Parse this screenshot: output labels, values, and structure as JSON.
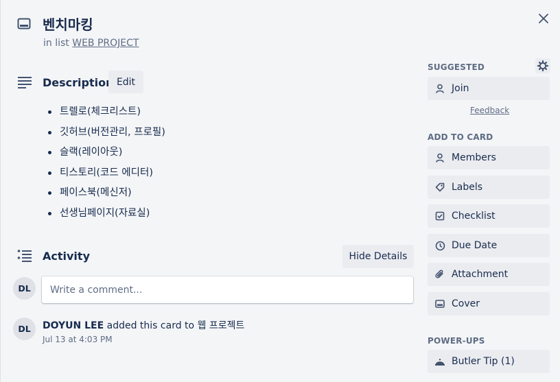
{
  "card": {
    "title": "벤치마킹",
    "in_list_prefix": "in list",
    "list_name": "WEB PROJECT",
    "header_icon": "card-icon"
  },
  "description": {
    "title": "Description",
    "edit_label": "Edit",
    "items": [
      "트렐로(체크리스트)",
      "깃허브(버전관리, 프로필)",
      "슬랙(레이아웃)",
      "티스토리(코드 에디터)",
      "페이스북(메신저)",
      "선생님페이지(자료실)"
    ]
  },
  "activity": {
    "title": "Activity",
    "hide_details_label": "Hide Details",
    "comment_placeholder": "Write a comment...",
    "current_user_initials": "DL",
    "entries": [
      {
        "initials": "DL",
        "author": "DOYUN LEE",
        "action": " added this card to 웹 프로젝트",
        "time": "Jul 13 at 4:03 PM"
      }
    ]
  },
  "sidebar": {
    "suggested_heading": "SUGGESTED",
    "join_label": "Join",
    "feedback_label": "Feedback",
    "add_to_card_heading": "ADD TO CARD",
    "add_items": [
      {
        "label": "Members",
        "icon": "person-icon"
      },
      {
        "label": "Labels",
        "icon": "tag-icon"
      },
      {
        "label": "Checklist",
        "icon": "checkbox-icon"
      },
      {
        "label": "Due Date",
        "icon": "clock-icon"
      },
      {
        "label": "Attachment",
        "icon": "paperclip-icon"
      },
      {
        "label": "Cover",
        "icon": "cover-icon"
      }
    ],
    "power_ups_heading": "POWER-UPS",
    "butler_label": "Butler Tip (1)"
  },
  "colors": {
    "background": "#f4f5f7",
    "button_bg": "#ebecf0",
    "text": "#172b4d",
    "muted": "#5e6c84"
  }
}
